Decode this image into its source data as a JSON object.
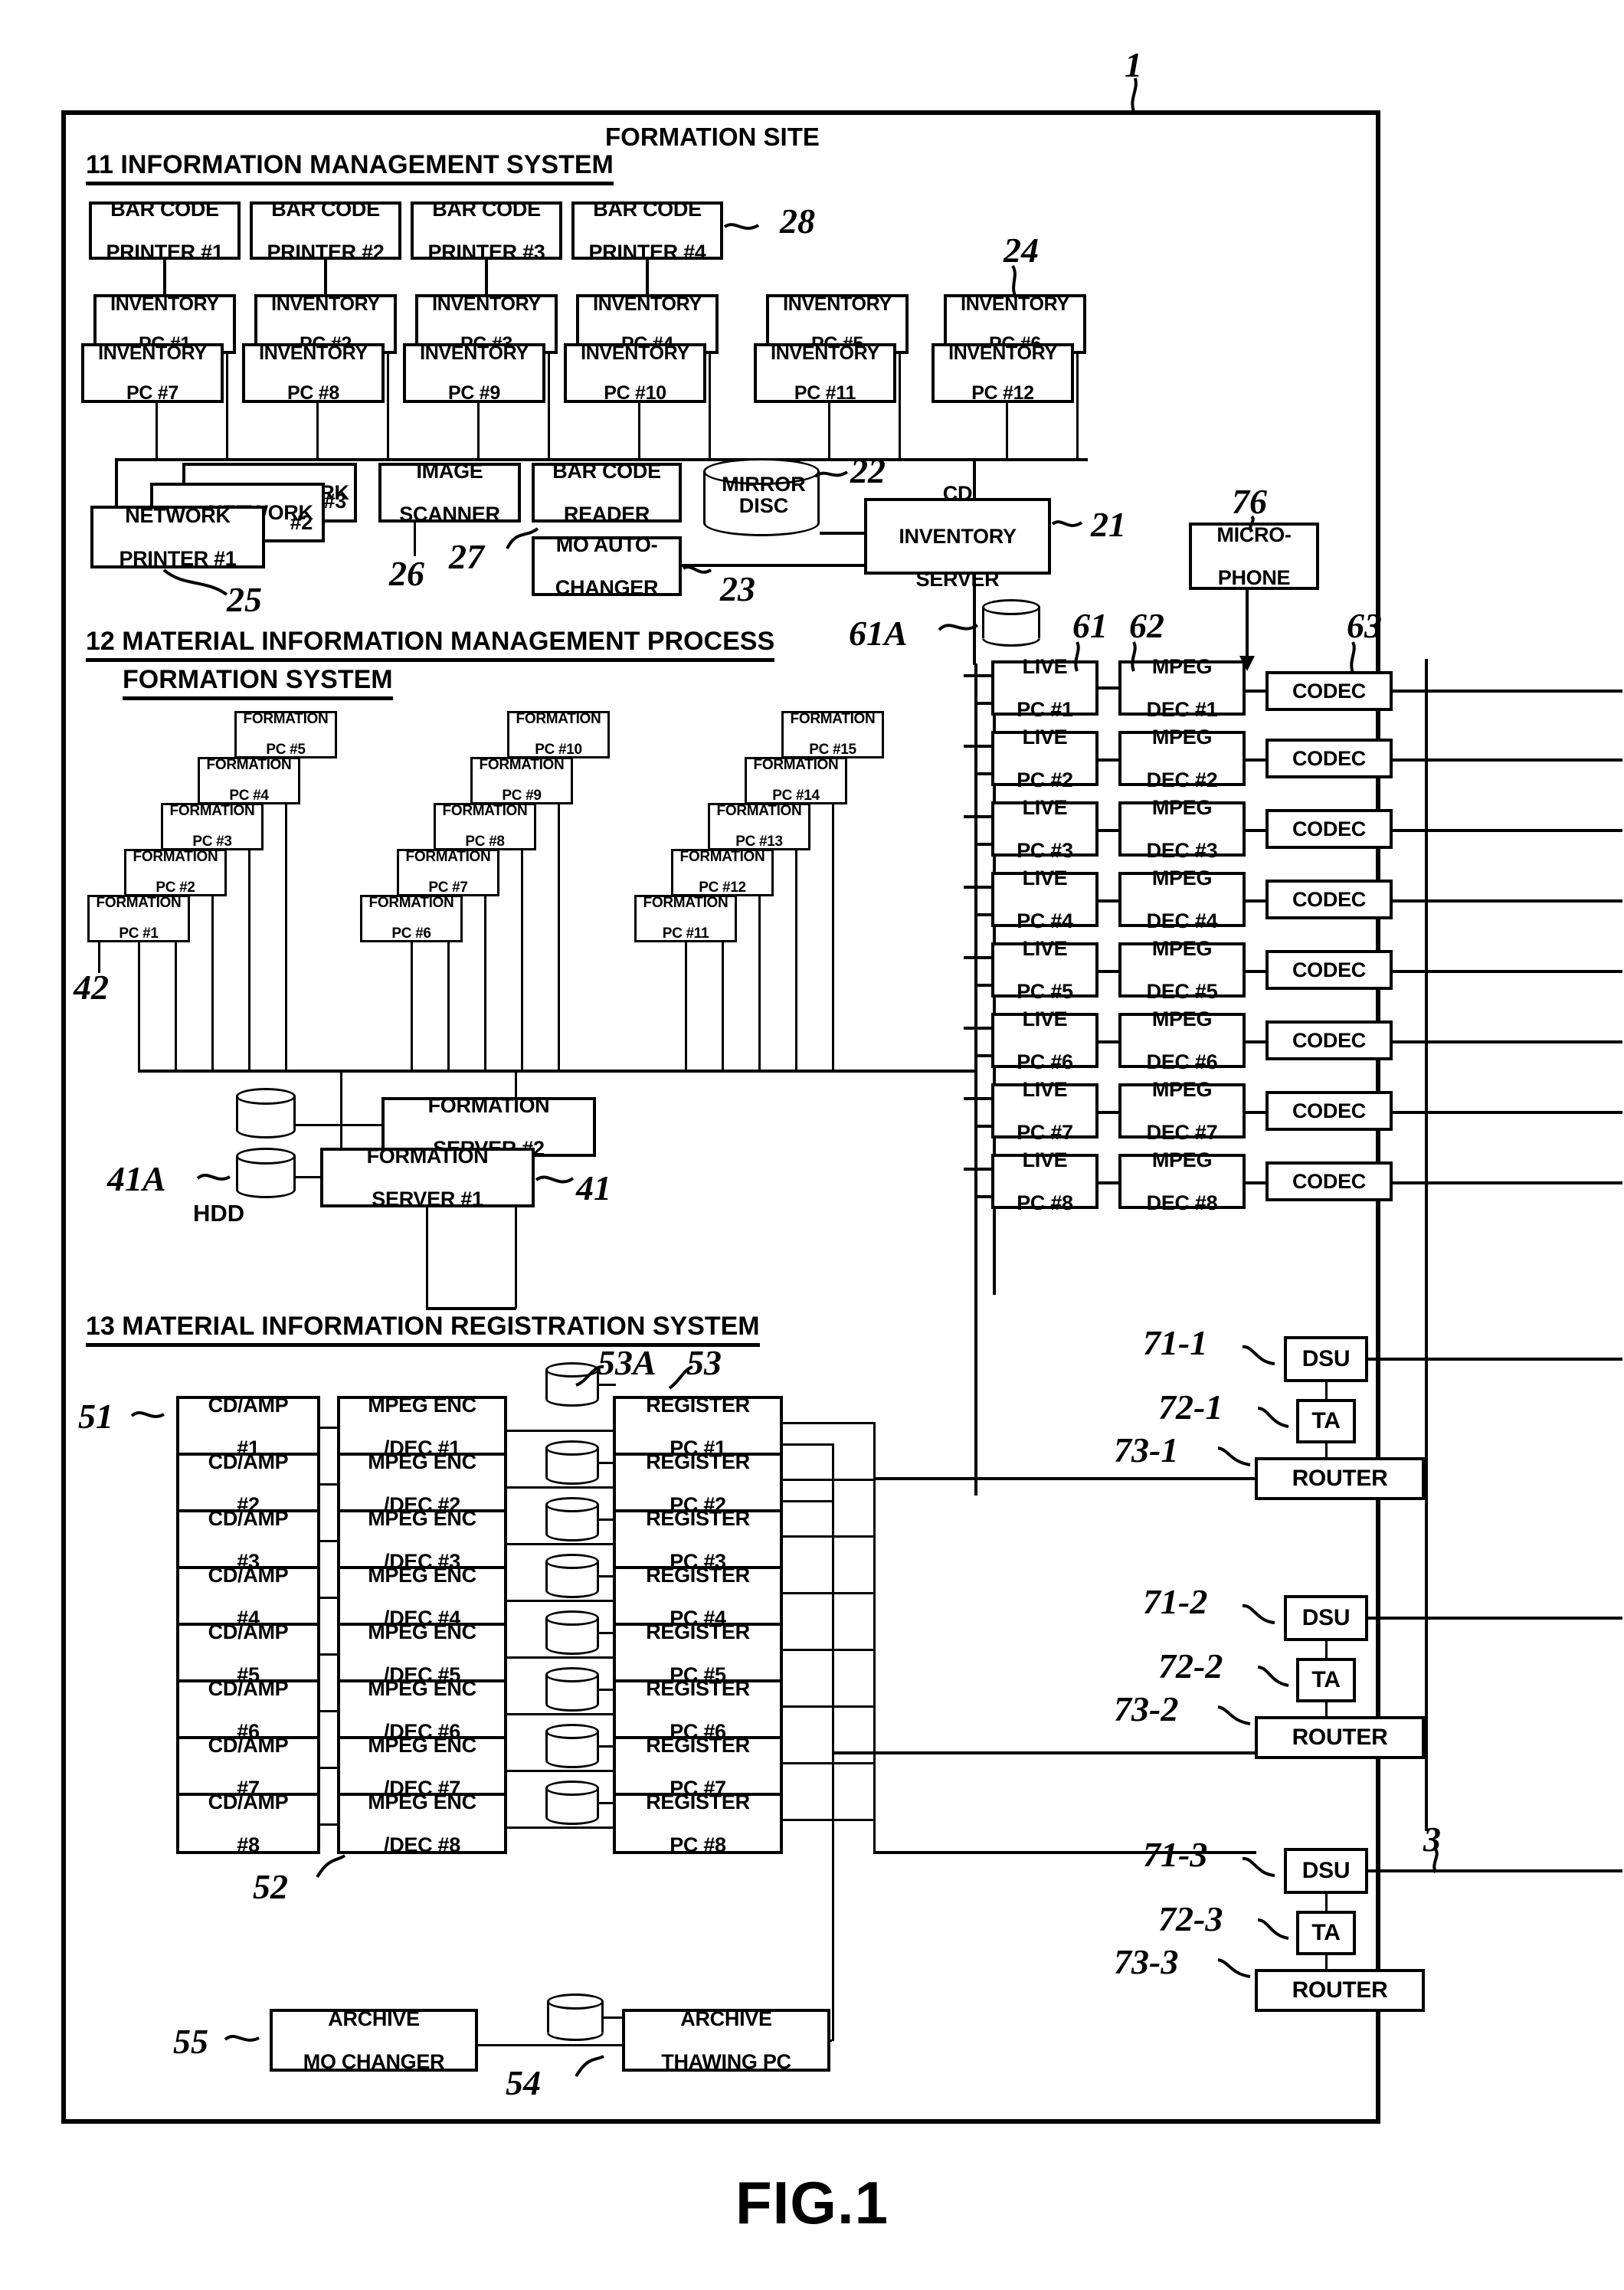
{
  "figure": {
    "caption": "FIG.1",
    "site_title": "FORMATION SITE",
    "site_ref": "1",
    "network_ref": "3"
  },
  "sections": {
    "info_mgmt": {
      "label": "11 INFORMATION MANAGEMENT SYSTEM"
    },
    "material_mgmt": {
      "label_line1": "12 MATERIAL INFORMATION MANAGEMENT PROCESS",
      "label_line2": "FORMATION SYSTEM"
    },
    "registration": {
      "label": "13 MATERIAL INFORMATION REGISTRATION SYSTEM"
    }
  },
  "bar_code_printers": {
    "ref": "28",
    "items": [
      {
        "l1": "BAR CODE",
        "l2": "PRINTER #1"
      },
      {
        "l1": "BAR CODE",
        "l2": "PRINTER #2"
      },
      {
        "l1": "BAR CODE",
        "l2": "PRINTER #3"
      },
      {
        "l1": "BAR CODE",
        "l2": "PRINTER #4"
      }
    ]
  },
  "inventory_pcs": {
    "ref": "24",
    "top_row": [
      {
        "l1": "INVENTORY",
        "l2": "PC #1"
      },
      {
        "l1": "INVENTORY",
        "l2": "PC #2"
      },
      {
        "l1": "INVENTORY",
        "l2": "PC #3"
      },
      {
        "l1": "INVENTORY",
        "l2": "PC #4"
      },
      {
        "l1": "INVENTORY",
        "l2": "PC #5"
      },
      {
        "l1": "INVENTORY",
        "l2": "PC #6"
      }
    ],
    "bottom_row": [
      {
        "l1": "INVENTORY",
        "l2": "PC #7"
      },
      {
        "l1": "INVENTORY",
        "l2": "PC #8"
      },
      {
        "l1": "INVENTORY",
        "l2": "PC #9"
      },
      {
        "l1": "INVENTORY",
        "l2": "PC #10"
      },
      {
        "l1": "INVENTORY",
        "l2": "PC #11"
      },
      {
        "l1": "INVENTORY",
        "l2": "PC #12"
      }
    ]
  },
  "network_printers": {
    "ref": "25",
    "items": [
      {
        "l1": "NETWORK",
        "l2": "#3"
      },
      {
        "l1": "NETWORK",
        "l2": "#2"
      },
      {
        "l1": "NETWORK",
        "l2": "PRINTER #1"
      }
    ]
  },
  "peripherals": {
    "image_scanner": {
      "l1": "IMAGE",
      "l2": "SCANNER",
      "ref": "26"
    },
    "bar_code_reader": {
      "l1": "BAR CODE",
      "l2": "READER",
      "ref": "27"
    },
    "mo_auto_changer": {
      "l1": "MO AUTO-",
      "l2": "CHANGER",
      "ref": "23"
    },
    "mirror_disc": {
      "l1": "MIRROR",
      "l2": "DISC",
      "ref": "22"
    },
    "cd_inventory_server": {
      "l1": "CD",
      "l2": "INVENTORY",
      "l3": "SERVER",
      "ref": "21"
    }
  },
  "formation_pcs": {
    "ref": "42",
    "group1": [
      {
        "l1": "FORMATION",
        "l2": "PC #1"
      },
      {
        "l1": "FORMATION",
        "l2": "PC #2"
      },
      {
        "l1": "FORMATION",
        "l2": "PC #3"
      },
      {
        "l1": "FORMATION",
        "l2": "PC #4"
      },
      {
        "l1": "FORMATION",
        "l2": "PC #5"
      }
    ],
    "group2": [
      {
        "l1": "FORMATION",
        "l2": "PC #6"
      },
      {
        "l1": "FORMATION",
        "l2": "PC #7"
      },
      {
        "l1": "FORMATION",
        "l2": "PC #8"
      },
      {
        "l1": "FORMATION",
        "l2": "PC #9"
      },
      {
        "l1": "FORMATION",
        "l2": "PC #10"
      }
    ],
    "group3": [
      {
        "l1": "FORMATION",
        "l2": "PC #11"
      },
      {
        "l1": "FORMATION",
        "l2": "PC #12"
      },
      {
        "l1": "FORMATION",
        "l2": "PC #13"
      },
      {
        "l1": "FORMATION",
        "l2": "PC #14"
      },
      {
        "l1": "FORMATION",
        "l2": "PC #15"
      }
    ]
  },
  "formation_servers": {
    "ref": "41",
    "hdd_ref": "41A",
    "hdd_label": "HDD",
    "server1": {
      "l1": "FORMATION",
      "l2": "SERVER #1"
    },
    "server2": {
      "l1": "FORMATION",
      "l2": "SERVER #2"
    }
  },
  "live_chain": {
    "live_ref": "61",
    "live_disc_ref": "61A",
    "dec_ref": "62",
    "codec_ref": "63",
    "microphone": {
      "l1": "MICRO-",
      "l2": "PHONE",
      "ref": "76"
    },
    "rows": [
      {
        "live1": "LIVE",
        "live2": "PC #1",
        "dec1": "MPEG",
        "dec2": "DEC #1",
        "codec": "CODEC"
      },
      {
        "live1": "LIVE",
        "live2": "PC #2",
        "dec1": "MPEG",
        "dec2": "DEC #2",
        "codec": "CODEC"
      },
      {
        "live1": "LIVE",
        "live2": "PC #3",
        "dec1": "MPEG",
        "dec2": "DEC #3",
        "codec": "CODEC"
      },
      {
        "live1": "LIVE",
        "live2": "PC #4",
        "dec1": "MPEG",
        "dec2": "DEC #4",
        "codec": "CODEC"
      },
      {
        "live1": "LIVE",
        "live2": "PC #5",
        "dec1": "MPEG",
        "dec2": "DEC #5",
        "codec": "CODEC"
      },
      {
        "live1": "LIVE",
        "live2": "PC #6",
        "dec1": "MPEG",
        "dec2": "DEC #6",
        "codec": "CODEC"
      },
      {
        "live1": "LIVE",
        "live2": "PC #7",
        "dec1": "MPEG",
        "dec2": "DEC #7",
        "codec": "CODEC"
      },
      {
        "live1": "LIVE",
        "live2": "PC #8",
        "dec1": "MPEG",
        "dec2": "DEC #8",
        "codec": "CODEC"
      }
    ]
  },
  "registration_chain": {
    "cdamp_ref": "51",
    "mpeg_ref": "52",
    "register_ref": "53",
    "register_disc_ref": "53A",
    "rows": [
      {
        "amp1": "CD/AMP",
        "amp2": "#1",
        "enc1": "MPEG ENC",
        "enc2": "/DEC #1",
        "reg1": "REGISTER",
        "reg2": "PC #1"
      },
      {
        "amp1": "CD/AMP",
        "amp2": "#2",
        "enc1": "MPEG ENC",
        "enc2": "/DEC #2",
        "reg1": "REGISTER",
        "reg2": "PC #2"
      },
      {
        "amp1": "CD/AMP",
        "amp2": "#3",
        "enc1": "MPEG ENC",
        "enc2": "/DEC #3",
        "reg1": "REGISTER",
        "reg2": "PC #3"
      },
      {
        "amp1": "CD/AMP",
        "amp2": "#4",
        "enc1": "MPEG ENC",
        "enc2": "/DEC #4",
        "reg1": "REGISTER",
        "reg2": "PC #4"
      },
      {
        "amp1": "CD/AMP",
        "amp2": "#5",
        "enc1": "MPEG ENC",
        "enc2": "/DEC #5",
        "reg1": "REGISTER",
        "reg2": "PC #5"
      },
      {
        "amp1": "CD/AMP",
        "amp2": "#6",
        "enc1": "MPEG ENC",
        "enc2": "/DEC #6",
        "reg1": "REGISTER",
        "reg2": "PC #6"
      },
      {
        "amp1": "CD/AMP",
        "amp2": "#7",
        "enc1": "MPEG ENC",
        "enc2": "/DEC #7",
        "reg1": "REGISTER",
        "reg2": "PC #7"
      },
      {
        "amp1": "CD/AMP",
        "amp2": "#8",
        "enc1": "MPEG ENC",
        "enc2": "/DEC #8",
        "reg1": "REGISTER",
        "reg2": "PC #8"
      }
    ]
  },
  "archive": {
    "mo_changer": {
      "l1": "ARCHIVE",
      "l2": "MO CHANGER",
      "ref": "55"
    },
    "thawing_pc": {
      "l1": "ARCHIVE",
      "l2": "THAWING PC",
      "ref": "54"
    }
  },
  "wan_units": [
    {
      "dsu": "DSU",
      "ta": "TA",
      "router": "ROUTER",
      "dsu_ref": "71-1",
      "ta_ref": "72-1",
      "router_ref": "73-1"
    },
    {
      "dsu": "DSU",
      "ta": "TA",
      "router": "ROUTER",
      "dsu_ref": "71-2",
      "ta_ref": "72-2",
      "router_ref": "73-2"
    },
    {
      "dsu": "DSU",
      "ta": "TA",
      "router": "ROUTER",
      "dsu_ref": "71-3",
      "ta_ref": "72-3",
      "router_ref": "73-3"
    }
  ],
  "colors": {
    "ink": "#000000",
    "paper": "#ffffff"
  }
}
